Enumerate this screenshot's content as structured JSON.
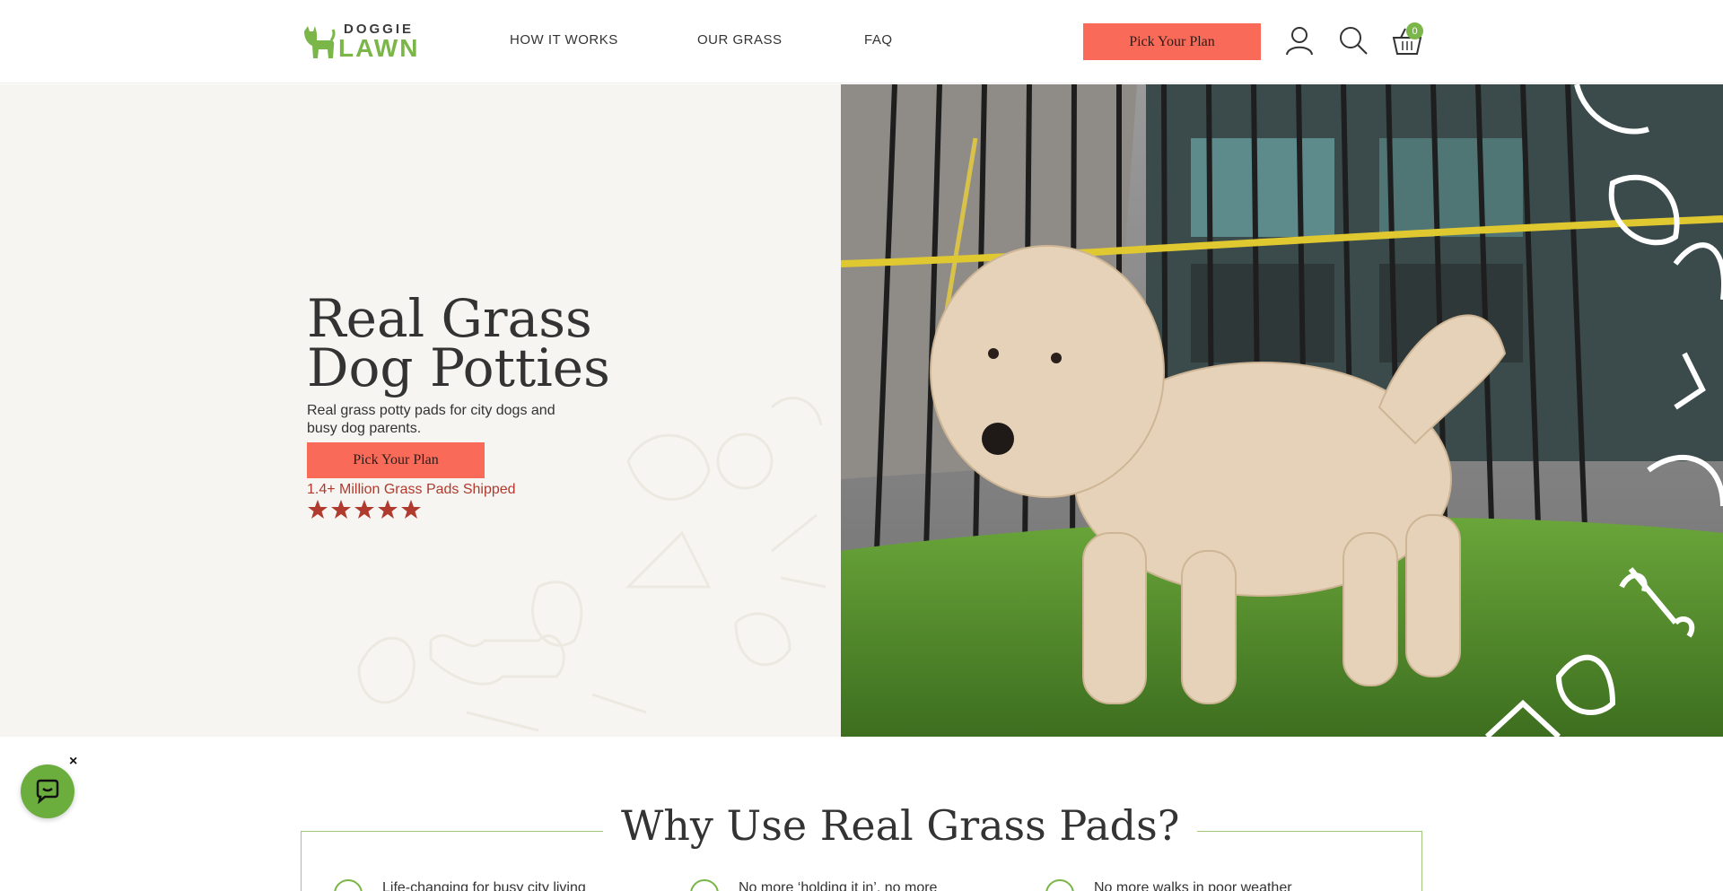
{
  "header": {
    "logo_top": "DOGGIE",
    "logo_bottom": "LAWN",
    "nav": [
      "HOW IT WORKS",
      "OUR GRASS",
      "FAQ"
    ],
    "cta_label": "Pick Your Plan",
    "cart_count": "0",
    "icons": [
      "user-icon",
      "search-icon",
      "basket-icon"
    ]
  },
  "hero": {
    "title_line1": "Real Grass",
    "title_line2": "Dog Potties",
    "subtitle": "Real grass potty pads for city dogs and busy dog parents.",
    "cta_label": "Pick Your Plan",
    "shipped": "1.4+ Million Grass Pads Shipped",
    "rating_stars": 5
  },
  "chat": {
    "close_label": "×"
  },
  "why": {
    "title": "Why Use Real Grass Pads?",
    "items": [
      "Life-changing for busy city living",
      "No more ‘holding it in’, no more",
      "No more walks in poor weather"
    ]
  },
  "colors": {
    "brand_green": "#7ab648",
    "coral": "#f96a59",
    "star_red": "#b03a2e",
    "hero_bg": "#f6f5f2"
  }
}
